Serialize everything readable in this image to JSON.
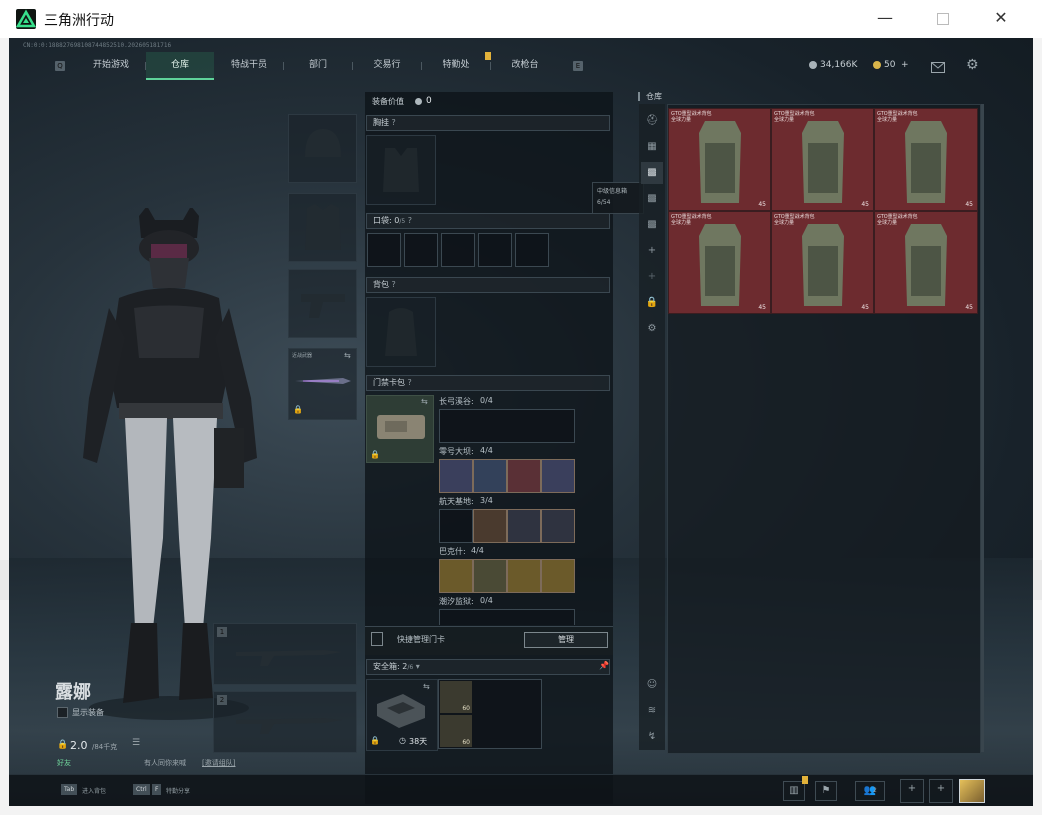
{
  "window": {
    "title": "三角洲行动",
    "min_icon": "minimize-icon",
    "max_icon": "maximize-icon",
    "close_icon": "close-icon"
  },
  "game": {
    "uid_text": "CN:0:0:188827698108744852510.202605181716",
    "nav_tabs": [
      "开始游戏",
      "仓库",
      "特战干员",
      "部门",
      "交易行",
      "特勤处",
      "改枪台"
    ],
    "active_tab": "仓库",
    "left_key": "Q",
    "right_key": "E",
    "currency": {
      "coins": "34,166K",
      "tickets": "50",
      "plus": "+"
    },
    "colors": {
      "accent": "#5fd39a",
      "alert": "#e2b23a",
      "crate_red": "#6d2b2f"
    }
  },
  "equipment": {
    "value_label": "装备价值",
    "value": "0",
    "chest_label": "胸挂",
    "pocket_label": "口袋:",
    "pocket_value": "0",
    "pocket_unit": "/5",
    "backpack_label": "背包",
    "keycard_label": "门禁卡包",
    "keycard_rows": [
      {
        "name": "长弓溪谷:",
        "count": "0/4"
      },
      {
        "name": "零号大坝:",
        "count": "4/4"
      },
      {
        "name": "航天基地:",
        "count": "3/4"
      },
      {
        "name": "巴克什:",
        "count": "4/4"
      },
      {
        "name": "潮汐监狱:",
        "count": "0/4"
      }
    ],
    "quick_manage_label": "快捷管理门卡",
    "manage_button": "管理",
    "safebox_label": "安全箱:",
    "safebox_value": "2",
    "safebox_unit": "/6",
    "safebox_days": "38天",
    "safebox_item_value": "60",
    "melee_label": "近战武器",
    "tooltip_title": "中级信息箱",
    "tooltip_count": "6/54",
    "slot1_badge": "1",
    "slot2_badge": "2"
  },
  "character": {
    "name": "露娜",
    "show_equipment": "显示装备",
    "weight": "2.0",
    "weight_unit": "/84千克"
  },
  "warehouse": {
    "title": "仓库",
    "crates": [
      {
        "label": "GTO重型战术背包 全球力量",
        "count": "45"
      },
      {
        "label": "GTO重型战术背包 全球力量",
        "count": "45"
      },
      {
        "label": "GTO重型战术背包 全球力量",
        "count": "45"
      },
      {
        "label": "GTO重型战术背包 全球力量",
        "count": "45"
      },
      {
        "label": "GTO重型战术背包 全球力量",
        "count": "45"
      },
      {
        "label": "GTO重型战术背包 全球力量",
        "count": "45"
      }
    ],
    "sidebar_icons": [
      "helmet-icon",
      "armor-icon",
      "qr-icon",
      "qr-icon",
      "qr-icon",
      "plus-icon",
      "plus-icon",
      "lock-icon",
      "gear-icon",
      "person-icon",
      "layers-icon",
      "tool-icon"
    ]
  },
  "footer": {
    "tab_key": "Tab",
    "tab_label": "进入背包",
    "ctrl_key": "Ctrl",
    "ctrl_key2": "F",
    "ctrl_label": "特勤分享",
    "invite_prefix": "好友",
    "invite_text": "有人同你来喊",
    "invite_link": "[邀请组队]",
    "friend_count": "2"
  }
}
